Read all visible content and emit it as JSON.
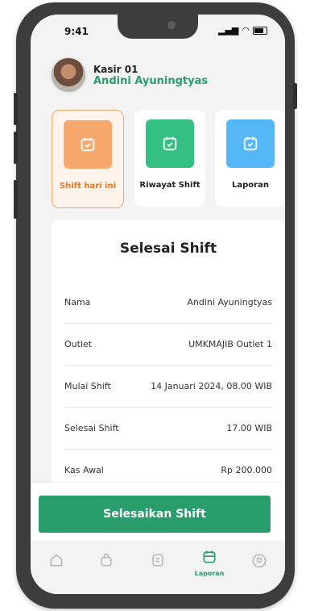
{
  "status_bar": {
    "time": "9:41"
  },
  "header": {
    "role": "Kasir 01",
    "name": "Andini Ayuningtyas"
  },
  "tiles": [
    {
      "label": "Shift hari ini",
      "color": "#f6a86d",
      "active": true
    },
    {
      "label": "Riwayat Shift",
      "color": "#35c083",
      "active": false
    },
    {
      "label": "Laporan",
      "color": "#55b7f5",
      "active": false
    }
  ],
  "card": {
    "title": "Selesai Shift",
    "rows": [
      {
        "label": "Nama",
        "value": "Andini Ayuningtyas"
      },
      {
        "label": "Outlet",
        "value": "UMKMAJIB Outlet 1"
      },
      {
        "label": "Mulai Shift",
        "value": "14 Januari 2024, 08.00 WIB"
      },
      {
        "label": "Selesai Shift",
        "value": "17.00 WIB"
      },
      {
        "label": "Kas Awal",
        "value": "Rp 200.000"
      }
    ]
  },
  "action": {
    "label": "Selesaikan Shift"
  },
  "nav": {
    "active_label": "Laporan",
    "items": [
      "home-icon",
      "bag-icon",
      "document-icon",
      "calendar-icon",
      "gear-icon"
    ]
  },
  "colors": {
    "accent": "#2a9d6c",
    "active_tile_border": "#f7a76a"
  }
}
